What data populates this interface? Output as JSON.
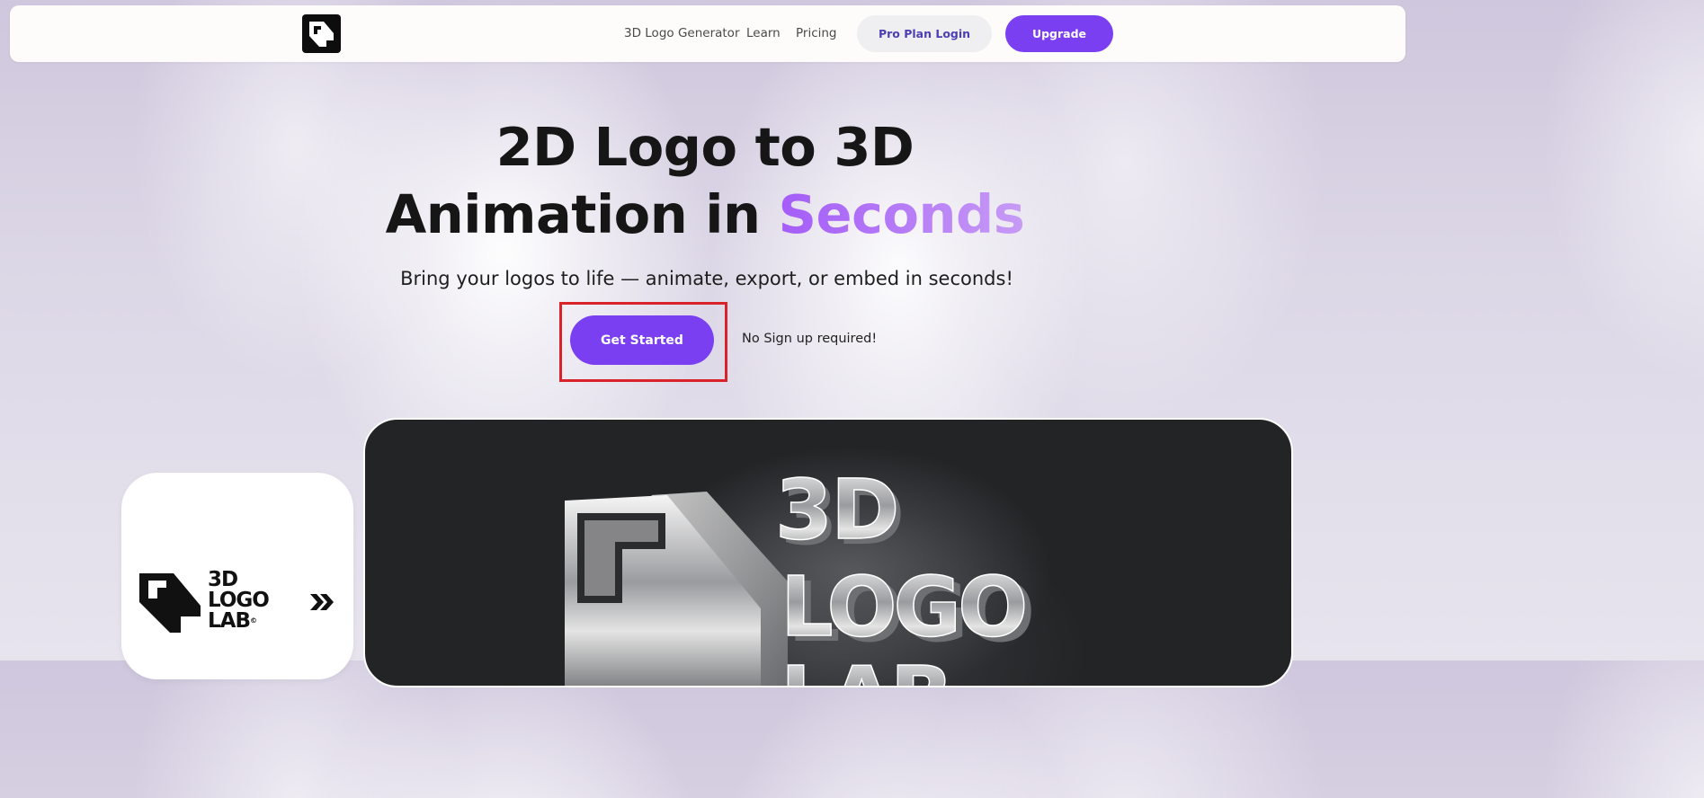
{
  "nav": {
    "logo_icon": "3d-logo-lab-mark",
    "links": [
      "3D Logo Generator",
      "Learn",
      "Pricing"
    ],
    "login_label": "Pro Plan Login",
    "upgrade_label": "Upgrade"
  },
  "hero": {
    "title_line1": "2D Logo to 3D",
    "title_line2_prefix": "Animation in ",
    "title_line2_highlight": "Seconds",
    "subtitle": "Bring your logos to life — animate, export, or embed in seconds!",
    "cta_label": "Get Started",
    "cta_note": "No Sign up required!"
  },
  "showcase": {
    "flat_logo_lines": [
      "3D",
      "LOGO",
      "LAB"
    ],
    "copyright_mark": "©",
    "arrow_icon": "double-chevron-right-icon",
    "preview_lines": [
      "3D",
      "LOGO",
      "LAB"
    ]
  },
  "colors": {
    "accent": "#7b3ff2",
    "highlight_gradient_start": "#a45cf8",
    "highlight_gradient_end": "#c79bf5",
    "annotation_box": "#d8232a"
  }
}
